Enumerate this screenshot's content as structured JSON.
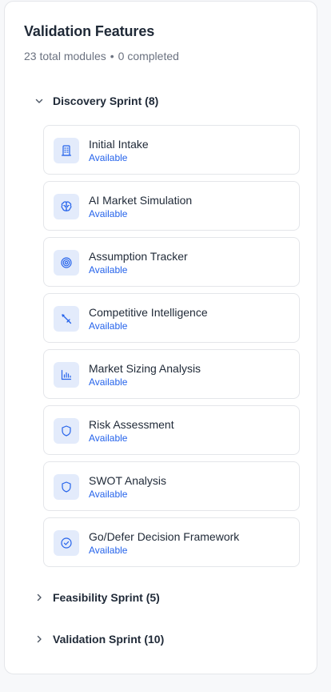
{
  "panel": {
    "title": "Validation Features",
    "total_modules": "23 total modules",
    "separator": "•",
    "completed": "0 completed"
  },
  "sections": [
    {
      "label": "Discovery Sprint (8)",
      "expanded": true,
      "modules": [
        {
          "name": "Initial Intake",
          "status": "Available",
          "icon": "building-icon"
        },
        {
          "name": "AI Market Simulation",
          "status": "Available",
          "icon": "brain-icon"
        },
        {
          "name": "Assumption Tracker",
          "status": "Available",
          "icon": "target-icon"
        },
        {
          "name": "Competitive Intelligence",
          "status": "Available",
          "icon": "sword-icon"
        },
        {
          "name": "Market Sizing Analysis",
          "status": "Available",
          "icon": "bar-chart-icon"
        },
        {
          "name": "Risk Assessment",
          "status": "Available",
          "icon": "shield-icon"
        },
        {
          "name": "SWOT Analysis",
          "status": "Available",
          "icon": "shield-icon"
        },
        {
          "name": "Go/Defer Decision Framework",
          "status": "Available",
          "icon": "check-circle-icon"
        }
      ]
    },
    {
      "label": "Feasibility Sprint (5)",
      "expanded": false
    },
    {
      "label": "Validation Sprint (10)",
      "expanded": false
    }
  ],
  "colors": {
    "accent": "#2563eb",
    "icon_bg": "#e3ebfb",
    "border": "#e4e6ea",
    "muted_text": "#6b7280"
  }
}
